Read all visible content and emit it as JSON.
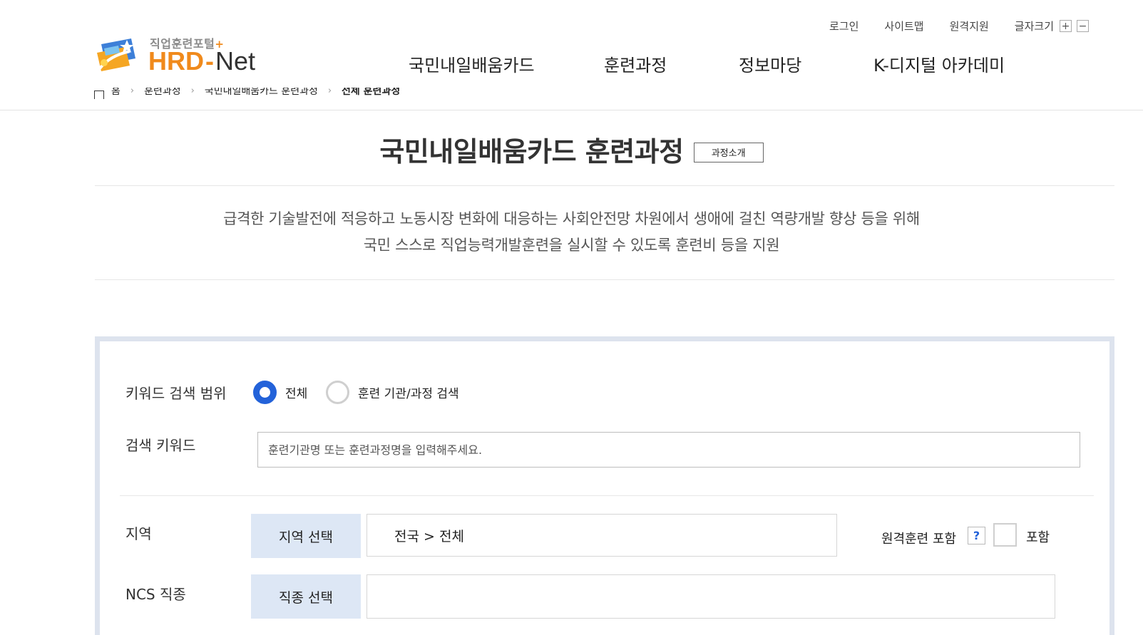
{
  "header": {
    "util_links": [
      "로그인",
      "사이트맵",
      "원격지원"
    ],
    "font_size_label": "글자크기",
    "font_size_increase": "+",
    "font_size_decrease": "−",
    "logo_subtitle": "직업훈련포털",
    "logo_plus": "+",
    "logo_hrd": "HRD",
    "logo_dash": "-",
    "logo_net": "Net",
    "logo_icon": "hrd-net-emblem",
    "nav": [
      "국민내일배움카드",
      "훈련과정",
      "정보마당",
      "K-디지털 아카데미"
    ]
  },
  "breadcrumb": {
    "home": "홈",
    "items": [
      "훈련과정",
      "국민내일배움카드 훈련과정",
      "전체 훈련과정"
    ],
    "separator": "›"
  },
  "page": {
    "title": "국민내일배움카드 훈련과정",
    "intro_button": "과정소개",
    "description_line1": "급격한 기술발전에 적응하고 노동시장 변화에 대응하는 사회안전망 차원에서 생애에 걸친 역량개발 향상 등을 위해",
    "description_line2": "국민 스스로 직업능력개발훈련을 실시할 수 있도록 훈련비 등을 지원"
  },
  "search": {
    "scope_label": "키워드 검색 범위",
    "scope_options": [
      {
        "label": "전체",
        "checked": true
      },
      {
        "label": "훈련 기관/과정 검색",
        "checked": false
      }
    ],
    "keyword_label": "검색 키워드",
    "keyword_placeholder": "훈련기관명 또는 훈련과정명을 입력해주세요.",
    "keyword_value": "",
    "region_label": "지역",
    "region_button": "지역 선택",
    "region_value": "전국 > 전체",
    "remote_label": "원격훈련 포함",
    "remote_help": "?",
    "remote_checked": false,
    "remote_include": "포함",
    "ncs_label": "NCS 직종",
    "ncs_button": "직종 선택",
    "ncs_value": ""
  },
  "colors": {
    "accent": "#2362d9",
    "brand_orange": "#f08a1c",
    "search_border": "#dde3ee",
    "select_button_bg": "#dde7f5"
  }
}
